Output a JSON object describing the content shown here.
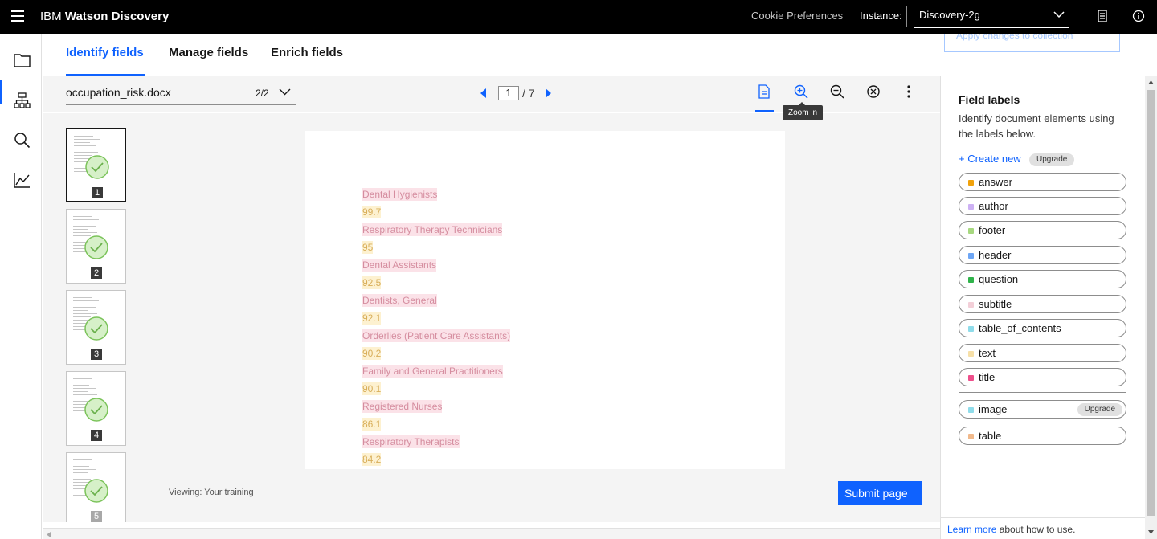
{
  "header": {
    "brand_prefix": "IBM",
    "brand_name": "Watson Discovery",
    "cookie_label": "Cookie Preferences",
    "instance_label": "Instance:",
    "instance_value": "Discovery-2g"
  },
  "tabs": [
    {
      "label": "Identify fields",
      "active": true
    },
    {
      "label": "Manage fields",
      "active": false
    },
    {
      "label": "Enrich fields",
      "active": false
    }
  ],
  "apply_button": "Apply changes to collection",
  "toolbar": {
    "document_name": "occupation_risk.docx",
    "document_count": "2/2",
    "current_page": "1",
    "total_pages": "/ 7",
    "zoom_tooltip": "Zoom in"
  },
  "thumbnails": [
    "1",
    "2",
    "3",
    "4",
    "5"
  ],
  "document_lines": [
    {
      "text": "Dental Hygienists",
      "label": "subtitle"
    },
    {
      "text": "99.7",
      "label": "text"
    },
    {
      "text": "Respiratory Therapy Technicians",
      "label": "subtitle"
    },
    {
      "text": "95",
      "label": "text"
    },
    {
      "text": "Dental Assistants",
      "label": "subtitle"
    },
    {
      "text": "92.5",
      "label": "text"
    },
    {
      "text": "Dentists, General",
      "label": "subtitle"
    },
    {
      "text": "92.1",
      "label": "text"
    },
    {
      "text": "Orderlies (Patient Care Assistants)",
      "label": "subtitle"
    },
    {
      "text": "90.2",
      "label": "text"
    },
    {
      "text": "Family and General Practitioners",
      "label": "subtitle"
    },
    {
      "text": "90.1",
      "label": "text"
    },
    {
      "text": "Registered Nurses",
      "label": "subtitle"
    },
    {
      "text": "86.1",
      "label": "text"
    },
    {
      "text": "Respiratory Therapists",
      "label": "subtitle"
    },
    {
      "text": "84.2",
      "label": "text"
    }
  ],
  "viewing_text": "Viewing: Your training",
  "submit_label": "Submit page",
  "field_panel": {
    "title": "Field labels",
    "description": "Identify document elements using the labels below.",
    "create_new": "+ Create new",
    "upgrade_tag": "Upgrade",
    "labels": [
      {
        "name": "answer",
        "color": "#f1a20b"
      },
      {
        "name": "author",
        "color": "#cdb1f4"
      },
      {
        "name": "footer",
        "color": "#a7d87f"
      },
      {
        "name": "header",
        "color": "#6ea6f5"
      },
      {
        "name": "question",
        "color": "#2fb34a"
      },
      {
        "name": "subtitle",
        "color": "#f3cfd8"
      },
      {
        "name": "table_of_contents",
        "color": "#8fdcea"
      },
      {
        "name": "text",
        "color": "#f7e0a8"
      },
      {
        "name": "title",
        "color": "#ee4f8b"
      }
    ],
    "extra_labels": [
      {
        "name": "image",
        "color": "#8fdcea",
        "upgrade": "Upgrade"
      },
      {
        "name": "table",
        "color": "#f1b98b"
      }
    ],
    "learn_more_link": "Learn more",
    "learn_more_rest": " about how to use."
  }
}
